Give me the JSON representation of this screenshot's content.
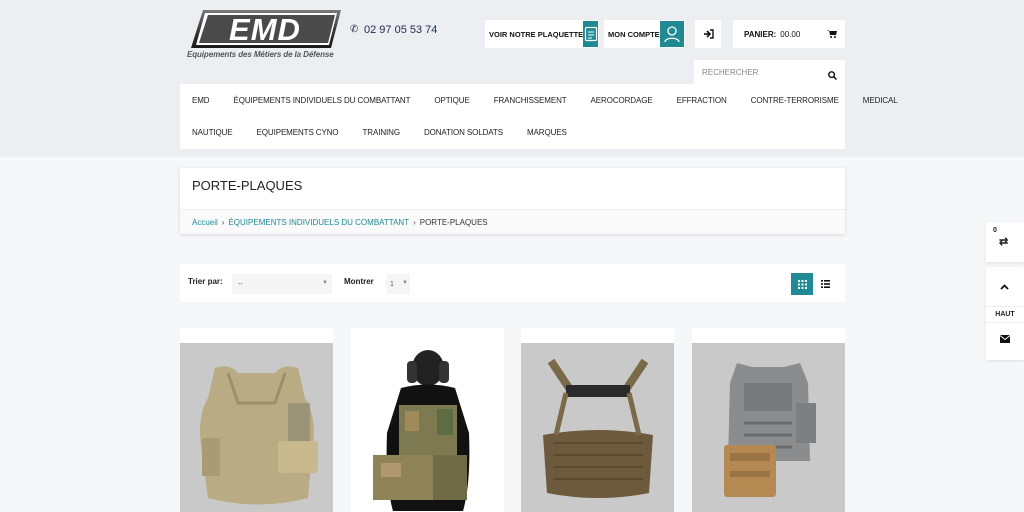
{
  "brand": {
    "logo_text": "EMD",
    "tagline": "Equipements des Métiers de la Défense",
    "phone": "02 97 05 53 74"
  },
  "header": {
    "plaquette_label": "VOIR NOTRE PLAQUETTE",
    "account_label": "MON COMPTE",
    "cart_label": "PANIER:",
    "cart_total": "00.00",
    "search_placeholder": "RECHERCHER"
  },
  "nav": {
    "row1": [
      "EMD",
      "ÉQUIPEMENTS INDIVIDUELS DU COMBATTANT",
      "OPTIQUE",
      "FRANCHISSEMENT",
      "AEROCORDAGE",
      "EFFRACTION",
      "CONTRE-TERRORISME",
      "MEDICAL"
    ],
    "row2": [
      "NAUTIQUE",
      "EQUIPEMENTS CYNO",
      "TRAINING",
      "DONATION SOLDATS",
      "MARQUES"
    ]
  },
  "page": {
    "title": "PORTE-PLAQUES",
    "breadcrumb": [
      "Accueil",
      "ÉQUIPEMENTS INDIVIDUELS DU COMBATTANT",
      "PORTE-PLAQUES"
    ]
  },
  "toolbar": {
    "sort_label": "Trier par:",
    "sort_value": "--",
    "show_label": "Montrer",
    "show_value": "1"
  },
  "side": {
    "compare_count": "0",
    "top_label": "HAUT"
  },
  "colors": {
    "accent": "#1f8a93",
    "header_band": "#eceef2",
    "product_bg": "#c9c9c9"
  },
  "icons": [
    "phone-icon",
    "document-icon",
    "user-icon",
    "login-icon",
    "cart-icon",
    "search-icon",
    "grid-view-icon",
    "list-view-icon",
    "compare-icon",
    "chevron-up-icon",
    "mail-icon"
  ]
}
